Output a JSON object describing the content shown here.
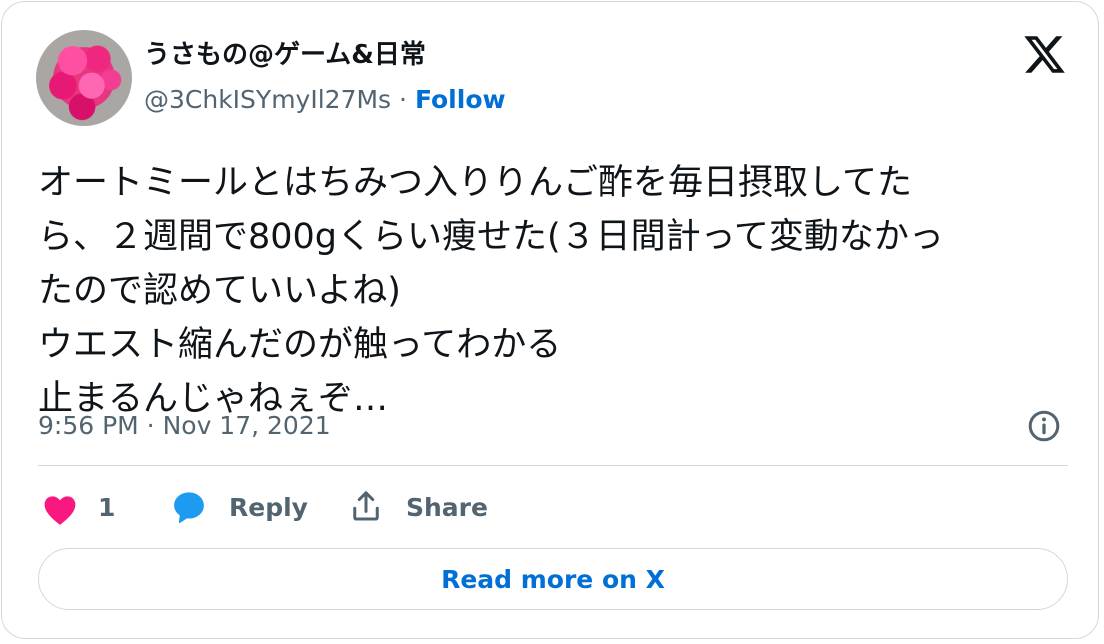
{
  "user": {
    "display_name": "うさもの@ゲーム&日常",
    "handle": "@3ChkISYmyIl27Ms",
    "separator": "·",
    "follow_label": "Follow"
  },
  "tweet": {
    "text": "オートミールとはちみつ入りりんご酢を毎日摂取してた\nら、２週間で800gくらい痩せた(３日間計って変動なかっ\nたので認めていいよね)\nウエスト縮んだのが触ってわかる\n止まるんじゃねぇぞ…",
    "timestamp": "9:56 PM · Nov 17, 2021"
  },
  "actions": {
    "like_count": "1",
    "reply_label": "Reply",
    "share_label": "Share"
  },
  "footer": {
    "read_more_label": "Read more on X"
  },
  "icons": {
    "logo": "x-logo-icon",
    "like": "heart-icon",
    "reply": "speech-bubble-icon",
    "share": "share-arrow-icon",
    "info": "info-icon"
  },
  "colors": {
    "accent": "#006fd6",
    "heart": "#f91880",
    "reply": "#1d9bf0",
    "muted": "#536471",
    "border": "#cfd9de",
    "text": "#0f1419"
  }
}
